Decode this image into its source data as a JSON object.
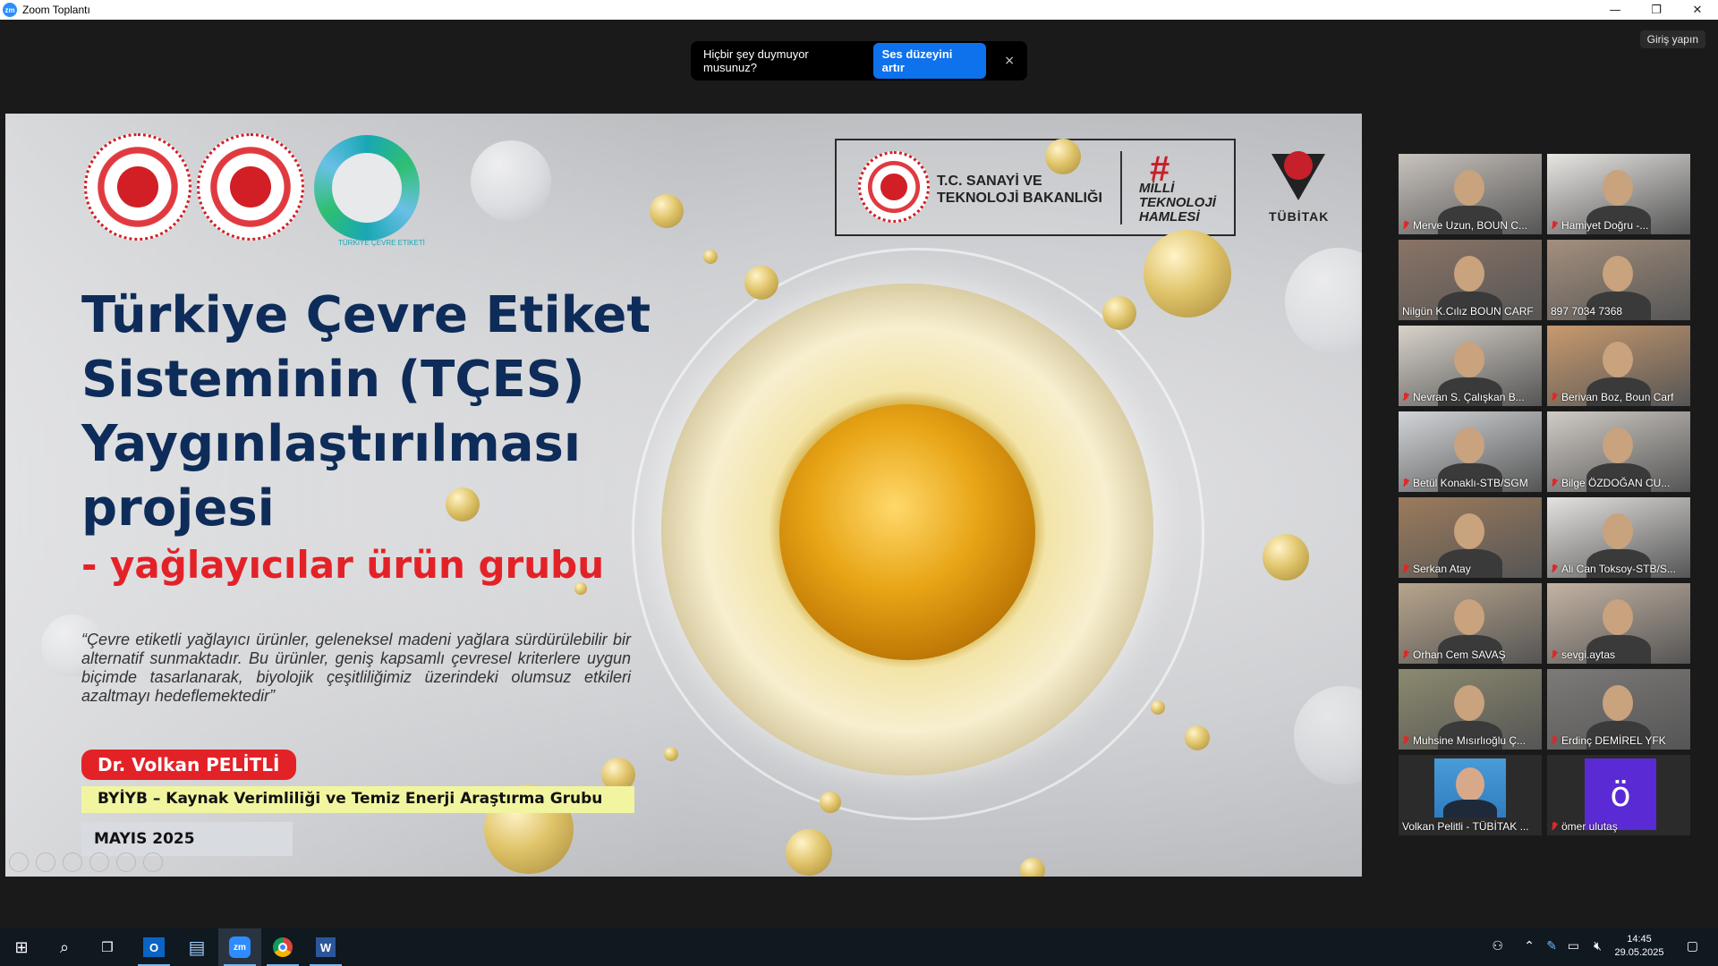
{
  "window": {
    "app_icon_text": "zm",
    "title": "Zoom Toplantı",
    "minimize": "—",
    "restore": "❐",
    "close": "✕"
  },
  "zoom": {
    "signin_label": "Giriş yapın",
    "notification": {
      "text": "Hiçbir şey duymuyor musunuz?",
      "button": "Ses düzeyini artır",
      "close": "×"
    }
  },
  "slide": {
    "logo_label_text": "TÜRKİYE ÇEVRE ETİKETİ",
    "ministry_line1": "T.C. SANAYİ VE",
    "ministry_line2": "TEKNOLOJİ BAKANLIĞI",
    "milli_hash": "#",
    "milli_text": "MİLLİ TEKNOLOJİ HAMLESİ",
    "tubitak": "TÜBİTAK",
    "title_lines": [
      "Türkiye Çevre Etiket",
      "Sisteminin (TÇES)",
      "Yaygınlaştırılması",
      "projesi"
    ],
    "subtitle": "- yağlayıcılar ürün grubu",
    "quote": "“Çevre etiketli yağlayıcı ürünler, geleneksel madeni yağlara sürdürülebilir bir alternatif sunmaktadır. Bu ürünler, geniş kapsamlı çevresel kriterlere uygun biçimde tasarlanarak, biyolojik çeşitliliğimiz üzerindeki olumsuz etkileri azaltmayı hedeflemektedir”",
    "presenter": "Dr. Volkan PELİTLİ",
    "group": "BYİYB – Kaynak Verimliliği ve Temiz Enerji Araştırma Grubu",
    "date": "MAYIS 2025"
  },
  "participants": [
    {
      "name": "Merve Uzun, BOUN C...",
      "muted": true,
      "kind": "video",
      "bg": "#c9c3bd"
    },
    {
      "name": "Hamiyet Doğru -...",
      "muted": true,
      "kind": "video",
      "bg": "#e8e6e3"
    },
    {
      "name": "Nilgün K.Cılız BOUN CARF",
      "muted": false,
      "kind": "video",
      "bg": "#8a7466"
    },
    {
      "name": "897 7034 7368",
      "muted": false,
      "kind": "video",
      "bg": "#a48f7d",
      "active": true
    },
    {
      "name": "Nevran S. Çalışkan B...",
      "muted": true,
      "kind": "video",
      "bg": "#d8d2ca"
    },
    {
      "name": "Berivan Boz, Boun Carf",
      "muted": true,
      "kind": "video",
      "bg": "#c89a6e"
    },
    {
      "name": "Betül Konaklı-STB/SGM",
      "muted": true,
      "kind": "video",
      "bg": "#d2d5d8"
    },
    {
      "name": "Bilge ÖZDOĞAN CU...",
      "muted": true,
      "kind": "video",
      "bg": "#d0cbc5"
    },
    {
      "name": "Serkan Atay",
      "muted": true,
      "kind": "video",
      "bg": "#9c7b5c"
    },
    {
      "name": "Ali Can Toksoy-STB/S...",
      "muted": true,
      "kind": "video",
      "bg": "#e4e2e0"
    },
    {
      "name": "Orhan Cem SAVAŞ",
      "muted": true,
      "kind": "video",
      "bg": "#b8a58c"
    },
    {
      "name": "sevgi.aytas",
      "muted": true,
      "kind": "video",
      "bg": "#c4b3a3"
    },
    {
      "name": "Muhsine Mısırlıoğlu Ç...",
      "muted": true,
      "kind": "video",
      "bg": "#8c8a6e"
    },
    {
      "name": "Erdinç DEMİREL YFK",
      "muted": true,
      "kind": "video",
      "bg": "#7d7a78"
    },
    {
      "name": "Volkan Pelitli - TÜBİTAK ...",
      "muted": false,
      "kind": "photo",
      "bg": "#2b2b2b"
    },
    {
      "name": "ömer ulutaş",
      "muted": true,
      "kind": "letter",
      "letter": "ö",
      "bg": "#2b2b2b"
    }
  ],
  "taskbar": {
    "time": "14:45",
    "date": "29.05.2025",
    "apps": [
      {
        "name": "start",
        "icon": "⊞"
      },
      {
        "name": "search",
        "icon": "⌕"
      },
      {
        "name": "task-view",
        "icon": "❒"
      },
      {
        "name": "outlook",
        "icon": "O"
      },
      {
        "name": "notepad",
        "icon": "▤"
      },
      {
        "name": "zoom",
        "icon": "zm"
      },
      {
        "name": "chrome",
        "icon": "◉"
      },
      {
        "name": "word",
        "icon": "W"
      }
    ]
  },
  "colors": {
    "zoom_blue": "#0e72ed",
    "title_navy": "#0e2c59",
    "accent_red": "#e32228",
    "active_speaker": "#d4e157"
  }
}
